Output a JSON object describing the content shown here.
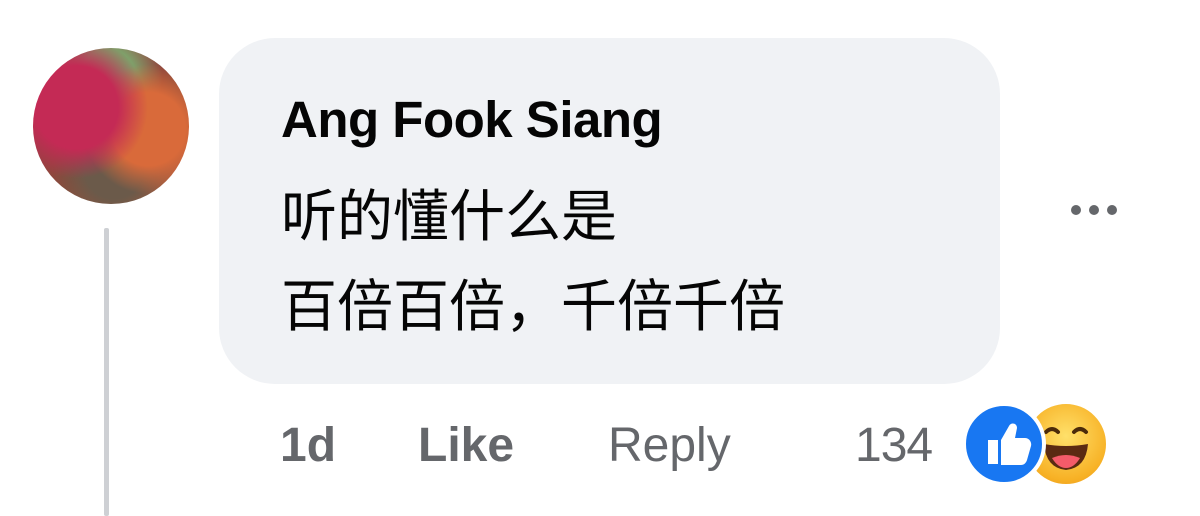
{
  "comment": {
    "author": "Ang Fook Siang",
    "lines": [
      "听的懂什么是",
      "百倍百倍，千倍千倍"
    ],
    "time": "1d",
    "like_label": "Like",
    "reply_label": "Reply",
    "reaction_count": "134",
    "reactions": [
      "like-icon",
      "haha-icon"
    ]
  },
  "colors": {
    "bubble_bg": "#f0f2f5",
    "meta_text": "#65676b",
    "like_blue": "#1877f2",
    "haha_yellow": "#f7b125"
  }
}
